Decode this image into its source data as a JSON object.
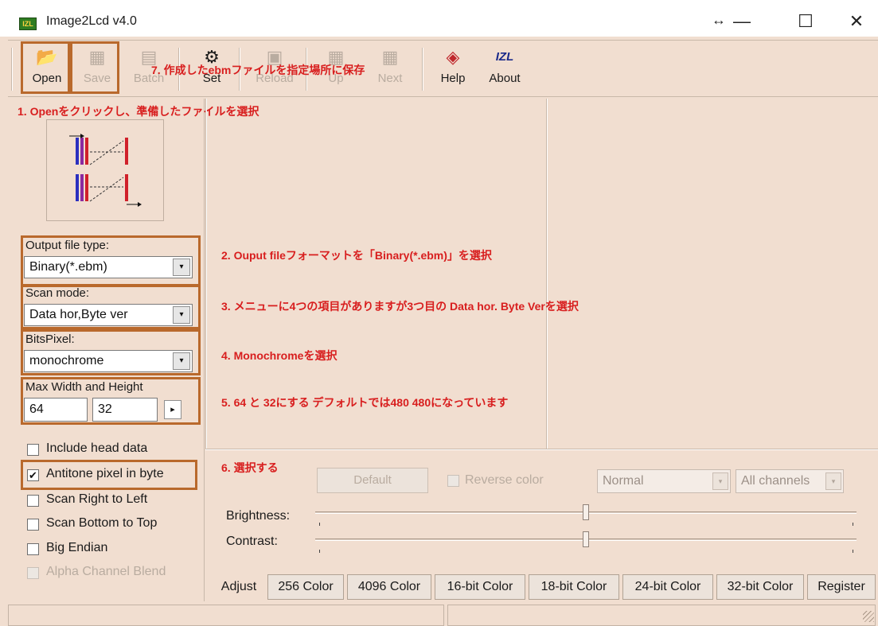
{
  "window": {
    "app_icon_text": "IZL",
    "title": "Image2Lcd v4.0",
    "restore_glyph": "↔",
    "minimize_glyph": "—",
    "maximize_glyph": "☐",
    "close_glyph": "✕"
  },
  "toolbar": {
    "buttons": [
      {
        "label": "Open",
        "icon": "📂",
        "icon_name": "open-folder-icon"
      },
      {
        "label": "Save",
        "icon": "▦",
        "icon_name": "save-disk-icon"
      },
      {
        "label": "Batch",
        "icon": "▤",
        "icon_name": "batch-icon"
      },
      {
        "label": "Set",
        "icon": "⚙",
        "icon_name": "settings-icon"
      },
      {
        "label": "Reload",
        "icon": "▣",
        "icon_name": "reload-icon"
      },
      {
        "label": "Up",
        "icon": "▦",
        "icon_name": "up-icon"
      },
      {
        "label": "Next",
        "icon": "▦",
        "icon_name": "next-icon"
      },
      {
        "label": "Help",
        "icon": "◈",
        "icon_name": "help-icon"
      },
      {
        "label": "About",
        "icon": "IZL",
        "icon_name": "about-logo-icon"
      }
    ]
  },
  "annotations": {
    "step1": "1. Openをクリックし、準備したファイルを選択",
    "step2": "2. Ouput fileフォーマットを「Binary(*.ebm)」を選択",
    "step3": "3. メニューに4つの項目がありますが3つ目の Data hor. Byte Verを選択",
    "step4": "4. Monochromeを選択",
    "step5": "5. 64 と 32にする デフォルトでは480 480になっています",
    "step6": "6. 選択する",
    "step7": "7. 作成したebmファイルを指定場所に保存"
  },
  "left_panel": {
    "output_label": "Output file type:",
    "output_value": "Binary(*.ebm)",
    "scan_label": "Scan mode:",
    "scan_value": "Data hor,Byte ver",
    "bits_label": "BitsPixel:",
    "bits_value": "monochrome",
    "maxwh_label": "Max Width and Height",
    "width_value": "64",
    "height_value": "32",
    "spin_glyph": "▸",
    "checkboxes": [
      {
        "label": "Include head data",
        "checked": false,
        "enabled": true
      },
      {
        "label": "Antitone pixel in byte",
        "checked": true,
        "enabled": true
      },
      {
        "label": "Scan Right to Left",
        "checked": false,
        "enabled": true
      },
      {
        "label": "Scan Bottom to Top",
        "checked": false,
        "enabled": true
      },
      {
        "label": "Big Endian",
        "checked": false,
        "enabled": true
      },
      {
        "label": "Alpha Channel Blend",
        "checked": false,
        "enabled": false
      }
    ],
    "check_glyph": "✔"
  },
  "adjust": {
    "default_button": "Default",
    "reverse_label": "Reverse color",
    "mode_value": "Normal",
    "channel_value": "All channels",
    "dropdown_glyph": "▾",
    "brightness_label": "Brightness:",
    "contrast_label": "Contrast:",
    "brightness_level": 0.5,
    "contrast_level": 0.5
  },
  "tabs": [
    "Adjust",
    "256 Color",
    "4096 Color",
    "16-bit Color",
    "18-bit Color",
    "24-bit Color",
    "32-bit Color",
    "Register"
  ],
  "colors": {
    "panel_bg": "#f1ded0",
    "highlight_outline": "#b9692c",
    "annotation_red": "#d81e1e"
  }
}
